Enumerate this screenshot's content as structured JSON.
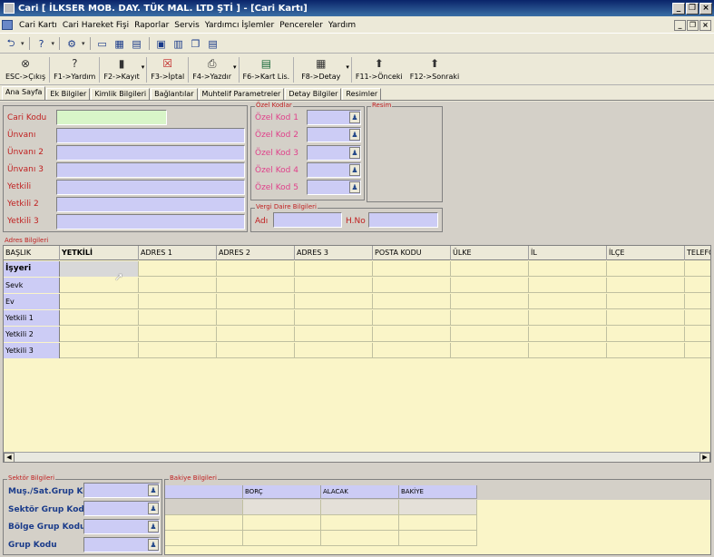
{
  "window": {
    "title": "Cari [ İLKSER MOB. DAY. TÜK MAL. LTD ŞTİ ] - [Cari Kartı]"
  },
  "menu": [
    "Cari Kartı",
    "Cari Hareket Fişi",
    "Raporlar",
    "Servis",
    "Yardımcı İşlemler",
    "Pencereler",
    "Yardım"
  ],
  "toolbar": [
    {
      "label": "ESC->Çıkış",
      "icon": "exit-icon"
    },
    {
      "label": "F1->Yardım",
      "icon": "help-icon"
    },
    {
      "label": "F2->Kayıt",
      "icon": "save-icon"
    },
    {
      "label": "F3->İptal",
      "icon": "cancel-icon"
    },
    {
      "label": "F4->Yazdır",
      "icon": "print-icon"
    },
    {
      "label": "F6->Kart Lis.",
      "icon": "card-list-icon"
    },
    {
      "label": "F8->Detay",
      "icon": "detail-icon"
    },
    {
      "label": "F11->Önceki",
      "icon": "arrow-up-icon"
    },
    {
      "label": "F12->Sonraki",
      "icon": "arrow-up-icon"
    }
  ],
  "tabs": [
    "Ana Sayfa",
    "Ek Bilgiler",
    "Kimlik Bilgileri",
    "Bağlantılar",
    "Muhtelif Parametreler",
    "Detay Bilgiler",
    "Resimler"
  ],
  "main": {
    "fields": [
      "Cari Kodu",
      "Ünvanı",
      "Ünvanı 2",
      "Ünvanı 3",
      "Yetkili",
      "Yetkili 2",
      "Yetkili 3"
    ],
    "ozel_kodlar": {
      "legend": "Özel Kodlar",
      "items": [
        "Özel Kod 1",
        "Özel Kod 2",
        "Özel Kod 3",
        "Özel Kod 4",
        "Özel Kod 5"
      ]
    },
    "resim": {
      "legend": "Resim"
    },
    "vergi": {
      "legend": "Vergi Daire Bilgileri",
      "adi": "Adı",
      "hno": "H.No"
    }
  },
  "adres": {
    "legend": "Adres Bilgileri",
    "columns": [
      "BAŞLIK",
      "YETKİLİ",
      "ADRES 1",
      "ADRES 2",
      "ADRES 3",
      "POSTA KODU",
      "ÜLKE",
      "İL",
      "İLÇE",
      "TELEFO"
    ],
    "rows": [
      "İşyeri",
      "Sevk",
      "Ev",
      "Yetkili 1",
      "Yetkili 2",
      "Yetkili 3"
    ]
  },
  "sektor": {
    "legend": "Sektör Bilgileri",
    "fields": [
      "Muş./Sat.Grup Kodu",
      "Sektör Grup Kodu",
      "Bölge Grup Kodu",
      "Grup Kodu"
    ]
  },
  "bakiye": {
    "legend": "Bakiye Bilgileri",
    "columns": [
      "BORÇ",
      "ALACAK",
      "BAKİYE"
    ]
  }
}
